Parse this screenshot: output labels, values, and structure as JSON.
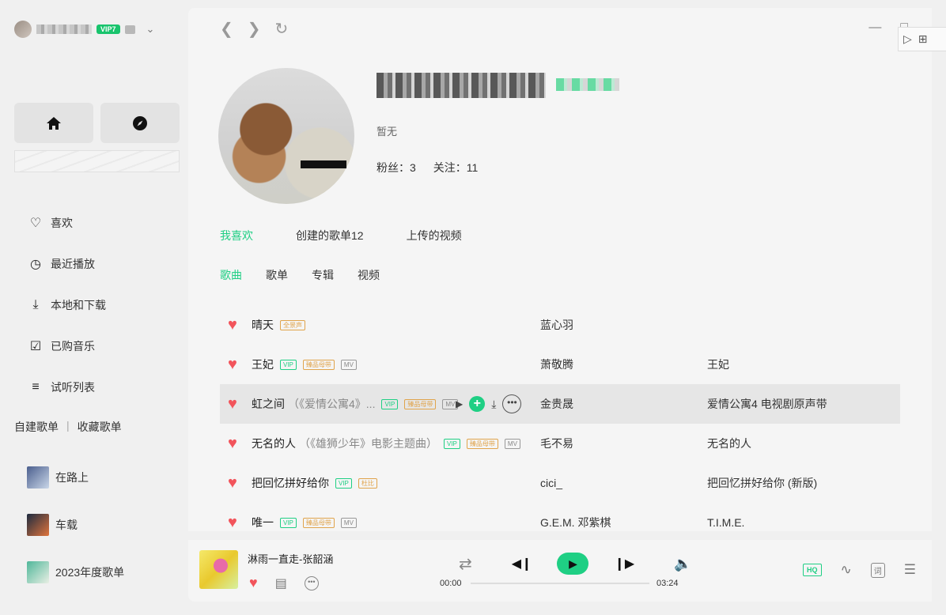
{
  "sidebar": {
    "vip_label": "VIP7",
    "menu": [
      {
        "icon": "heart-icon",
        "label": "喜欢"
      },
      {
        "icon": "clock-icon",
        "label": "最近播放"
      },
      {
        "icon": "download-icon",
        "label": "本地和下载"
      },
      {
        "icon": "purchased-icon",
        "label": "已购音乐"
      },
      {
        "icon": "playlist-icon",
        "label": "试听列表"
      }
    ],
    "playlist_tabs": [
      "自建歌单",
      "收藏歌单"
    ],
    "playlist_sep": "|",
    "playlists": [
      {
        "name": "在路上",
        "colors": [
          "#4b5f8e",
          "#c9d6e8"
        ]
      },
      {
        "name": "车载",
        "colors": [
          "#1c2b40",
          "#e0743c"
        ]
      },
      {
        "name": "2023年度歌单",
        "colors": [
          "#4fb79a",
          "#e9efe4"
        ]
      }
    ]
  },
  "profile": {
    "signature": "暂无",
    "fans_label": "粉丝：",
    "fans": "3",
    "follow_label": "关注：",
    "follow": "11"
  },
  "tabs_primary": [
    "我喜欢",
    "创建的歌单12",
    "上传的视频"
  ],
  "tabs_secondary": [
    "歌曲",
    "歌单",
    "专辑",
    "视频"
  ],
  "songs": [
    {
      "title": "晴天",
      "subtitle": "",
      "tags": [
        [
          "gold",
          "全景声"
        ]
      ],
      "artist": "蓝心羽",
      "album": "",
      "hover": false
    },
    {
      "title": "王妃",
      "subtitle": "",
      "tags": [
        [
          "vip",
          "VIP"
        ],
        [
          "gold",
          "臻品母带"
        ],
        [
          "mv",
          "MV"
        ]
      ],
      "artist": "萧敬腾",
      "album": "王妃",
      "hover": false
    },
    {
      "title": "虹之间",
      "subtitle": "（《爱情公寓4》...",
      "tags": [
        [
          "vip",
          "VIP"
        ],
        [
          "gold",
          "臻品母带"
        ],
        [
          "mv",
          "MV"
        ]
      ],
      "artist": "金贵晟",
      "album": "爱情公寓4 电视剧原声带",
      "hover": true
    },
    {
      "title": "无名的人",
      "subtitle": "（《雄狮少年》电影主题曲）",
      "tags": [
        [
          "vip",
          "VIP"
        ],
        [
          "gold",
          "臻品母带"
        ],
        [
          "mv",
          "MV"
        ]
      ],
      "artist": "毛不易",
      "album": "无名的人",
      "hover": false
    },
    {
      "title": "把回忆拼好给你",
      "subtitle": "",
      "tags": [
        [
          "vip",
          "VIP"
        ],
        [
          "gold",
          "杜比"
        ]
      ],
      "artist": "cici_",
      "album": "把回忆拼好给你 (新版)",
      "hover": false
    },
    {
      "title": "唯一",
      "subtitle": "",
      "tags": [
        [
          "vip",
          "VIP"
        ],
        [
          "gold",
          "臻品母带"
        ],
        [
          "mv",
          "MV"
        ]
      ],
      "artist": "G.E.M. 邓紫棋",
      "album": "T.I.M.E.",
      "hover": false
    }
  ],
  "player": {
    "now_playing": "淋雨一直走-张韶涵",
    "time_current": "00:00",
    "time_total": "03:24",
    "progress": 0,
    "quality": "HQ",
    "lyrics_label": "词"
  },
  "colors": {
    "accent": "#1fcf84",
    "heart": "#f2545b"
  }
}
